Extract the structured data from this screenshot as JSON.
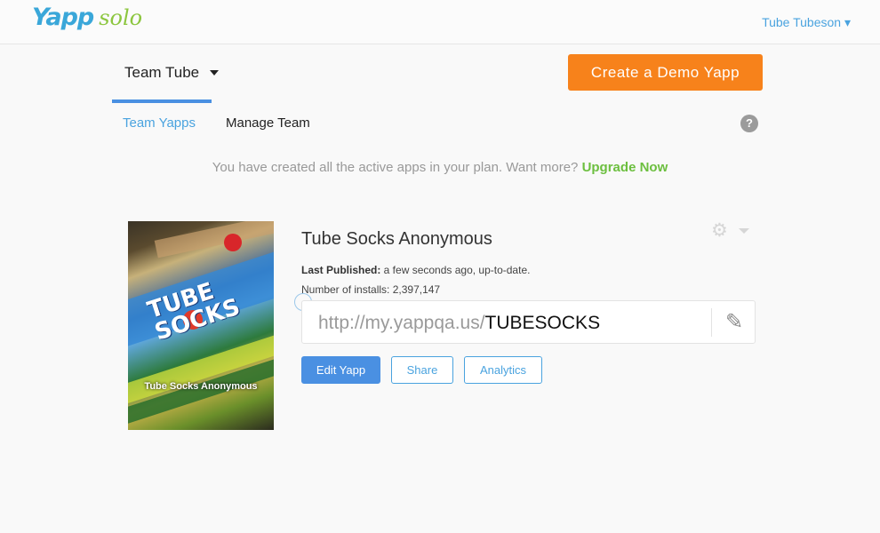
{
  "brand": {
    "name_primary": "Yapp",
    "name_secondary": "solo",
    "primary_color": "#3aa7d9",
    "secondary_color": "#8cc63f"
  },
  "header": {
    "user_menu_label": "Tube Tubeson ▾"
  },
  "team": {
    "name": "Team Tube",
    "dropdown_icon": "caret-down-icon"
  },
  "actions": {
    "create_demo_label": "Create a Demo Yapp",
    "create_demo_color": "#f7821b"
  },
  "subnav": {
    "items": [
      {
        "label": "Team Yapps",
        "active": true
      },
      {
        "label": "Manage Team",
        "active": false
      }
    ],
    "help_icon": "question-circle-icon",
    "help_glyph": "?"
  },
  "notice": {
    "message": "You have created all the active apps in your plan. Want more? ",
    "link_label": "Upgrade Now",
    "link_color": "#6cbf3f"
  },
  "app": {
    "title": "Tube Socks Anonymous",
    "thumbnail_caption": "Tube Socks Anonymous",
    "thumbnail_text": "TUBE SOCKS",
    "settings_icon": "gear-icon",
    "last_published_label": "Last Published:",
    "last_published_value": " a few seconds ago, up-to-date.",
    "installs_label": "Number of installs:",
    "installs_value": " 2,397,147",
    "url_base": "http://my.yappqa.us/",
    "url_slug": "TUBESOCKS",
    "edit_url_icon": "pencil-icon",
    "buttons": {
      "edit": "Edit Yapp",
      "share": "Share",
      "analytics": "Analytics"
    }
  },
  "colors": {
    "accent": "#4a90e2",
    "link": "#4aa3df"
  }
}
